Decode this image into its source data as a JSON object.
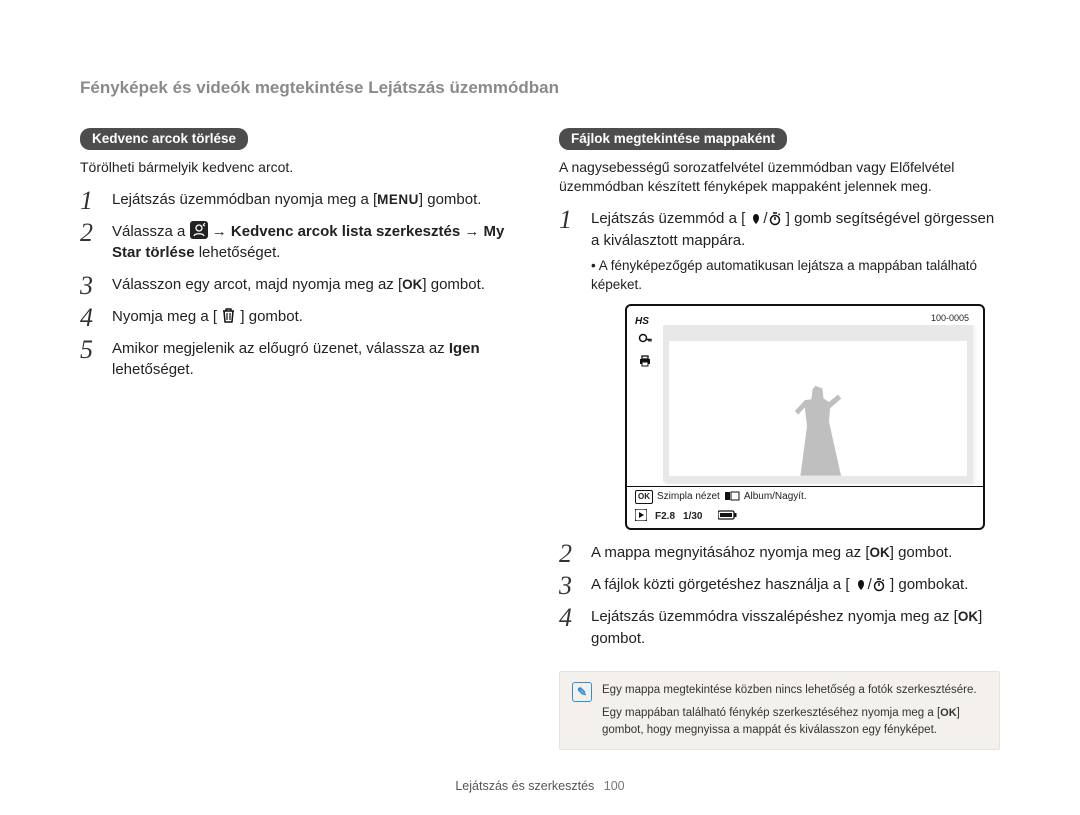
{
  "header": {
    "title": "Fényképek és videók megtekintése Lejátszás üzemmódban"
  },
  "left": {
    "pill": "Kedvenc arcok törlése",
    "intro": "Törölheti bármelyik kedvenc arcot.",
    "step1_a": "Lejátszás üzemmódban nyomja meg a [",
    "step1_menu": "MENU",
    "step1_b": "] gombot.",
    "step2_a": "Válassza a ",
    "step2_arrow": " → ",
    "step2_b": "Kedvenc arcok lista szerkesztés",
    "step2_c": " → ",
    "step2_d": "My Star törlése",
    "step2_e": " lehetőséget.",
    "step3_a": "Válasszon egy arcot, majd nyomja meg az [",
    "step3_ok": "OK",
    "step3_b": "] gombot.",
    "step4_a": "Nyomja meg a [",
    "step4_b": "] gombot.",
    "step5_a": "Amikor megjelenik az előugró üzenet, válassza az ",
    "step5_b": "Igen",
    "step5_c": " lehetőséget."
  },
  "right": {
    "pill": "Fájlok megtekintése mappaként",
    "intro": "A nagysebességű sorozatfelvétel üzemmódban vagy Előfelvétel üzemmódban készített fényképek mappaként jelennek meg.",
    "step1_a": "Lejátszás üzemmód a [",
    "step1_b": "] gomb segítségével görgessen a kiválasztott mappára.",
    "step1_sub": "A fényképezőgép automatikusan lejátsza a mappában található képeket.",
    "preview": {
      "counter": "100-0005",
      "row1_ok": "OK",
      "row1_a": "Szimpla nézet",
      "row1_b": "Album/Nagyít.",
      "row2_a": "F2.8",
      "row2_b": "1/30"
    },
    "step2_a": "A mappa megnyitásához nyomja meg az [",
    "step2_ok": "OK",
    "step2_b": "] gombot.",
    "step3_a": "A fájlok közti görgetéshez használja a [",
    "step3_b": "] gombokat.",
    "step4_a": "Lejátszás üzemmódra visszalépéshez nyomja meg az [",
    "step4_ok": "OK",
    "step4_b": "] gombot.",
    "note_line1": "Egy mappa megtekintése közben nincs lehetőség a fotók szerkesztésére.",
    "note_line2a": "Egy mappában található fénykép szerkesztéséhez nyomja meg a [",
    "note_line2_ok": "OK",
    "note_line2b": "] gombot, hogy megnyissa a mappát és kiválasszon egy fényképet."
  },
  "footer": {
    "section": "Lejátszás és szerkesztés",
    "page": "100"
  }
}
